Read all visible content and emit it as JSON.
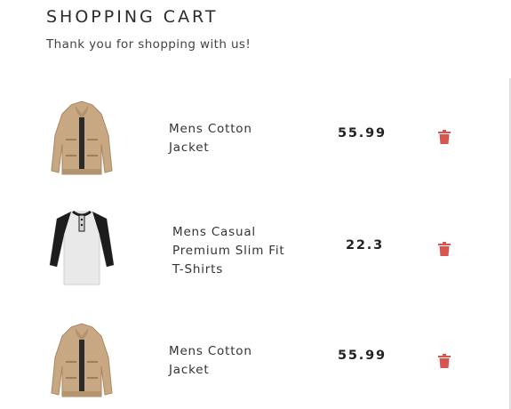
{
  "cart": {
    "title": "SHOPPING CART",
    "subtitle": "Thank you for shopping with us!"
  },
  "items": [
    {
      "name": "Mens Cotton Jacket",
      "price": "55.99",
      "image": "jacket",
      "delete_icon": "trash-icon"
    },
    {
      "name": "Mens Casual Premium Slim Fit T-Shirts",
      "price": "22.3",
      "image": "raglan-tshirt",
      "delete_icon": "trash-icon"
    },
    {
      "name": "Mens Cotton Jacket",
      "price": "55.99",
      "image": "jacket",
      "delete_icon": "trash-icon"
    }
  ],
  "colors": {
    "delete_icon": "#d9534f",
    "jacket": "#c8a883",
    "shirt_body": "#e9e9e9",
    "shirt_sleeve": "#1c1c1c"
  }
}
